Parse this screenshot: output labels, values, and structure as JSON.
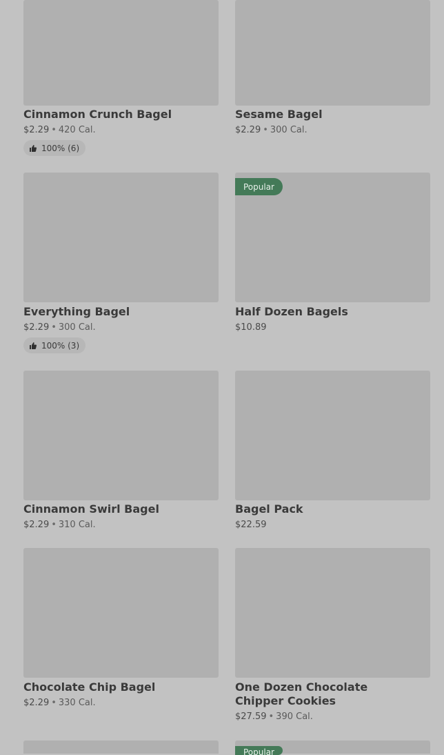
{
  "items": [
    {
      "name": "Cinnamon Crunch Bagel",
      "price": "$2.29",
      "cal": "420 Cal.",
      "rating": "100% (6)"
    },
    {
      "name": "Sesame Bagel",
      "price": "$2.29",
      "cal": "300 Cal."
    },
    {
      "name": "Everything Bagel",
      "price": "$2.29",
      "cal": "300 Cal.",
      "rating": "100% (3)"
    },
    {
      "name": "Half Dozen Bagels",
      "price": "$10.89",
      "badge": "Popular"
    },
    {
      "name": "Cinnamon Swirl Bagel",
      "price": "$2.29",
      "cal": "310 Cal."
    },
    {
      "name": "Bagel Pack",
      "price": "$22.59"
    },
    {
      "name": "Chocolate Chip Bagel",
      "price": "$2.29",
      "cal": "330 Cal."
    },
    {
      "name": "One Dozen Chocolate Chipper Cookies",
      "price": "$27.59",
      "cal": "390 Cal."
    },
    {
      "badge": "Popular"
    }
  ],
  "separator": "•",
  "colors": {
    "badge_bg": "#447a58",
    "image_placeholder": "#b0b0b0",
    "page_bg": "#c2c2c2"
  }
}
